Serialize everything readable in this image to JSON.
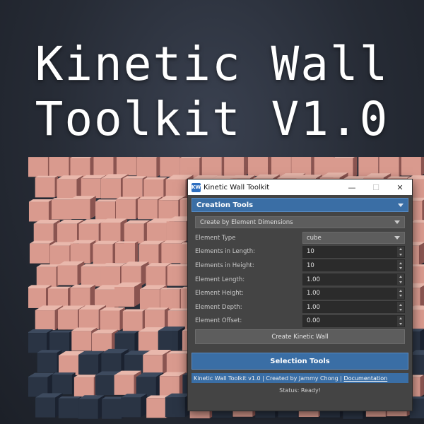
{
  "hero": {
    "line1": "Kinetic Wall",
    "line2": "Toolkit V1.0"
  },
  "window": {
    "icon_text": "KW",
    "title": "Kinetic Wall Toolkit",
    "minimize": "—",
    "maximize": "☐",
    "close": "✕"
  },
  "creation": {
    "header": "Creation Tools",
    "mode": "Create by Element Dimensions",
    "fields": [
      {
        "label": "Element Type",
        "value": "cube"
      },
      {
        "label": "Elements in Length:",
        "value": "10"
      },
      {
        "label": "Elements in Height:",
        "value": "10"
      },
      {
        "label": "Element Length:",
        "value": "1.00"
      },
      {
        "label": "Element Height:",
        "value": "1.00"
      },
      {
        "label": "Element Depth:",
        "value": "1.00"
      },
      {
        "label": "Element Offset:",
        "value": "0.00"
      }
    ],
    "create_button": "Create Kinetic Wall"
  },
  "selection": {
    "header": "Selection Tools"
  },
  "footer": {
    "credit": "Kinetic Wall Toolkit v1.0 | Created by Jammy Chong |",
    "link": "Documentation",
    "status": "Status: Ready!"
  },
  "colors": {
    "accent": "#3a6ea5",
    "panel": "#444444",
    "cube_face": "#d99a8e",
    "cube_top": "#e9b8ac",
    "cube_side": "#8a5450",
    "cube_dark": "#2a3444"
  }
}
